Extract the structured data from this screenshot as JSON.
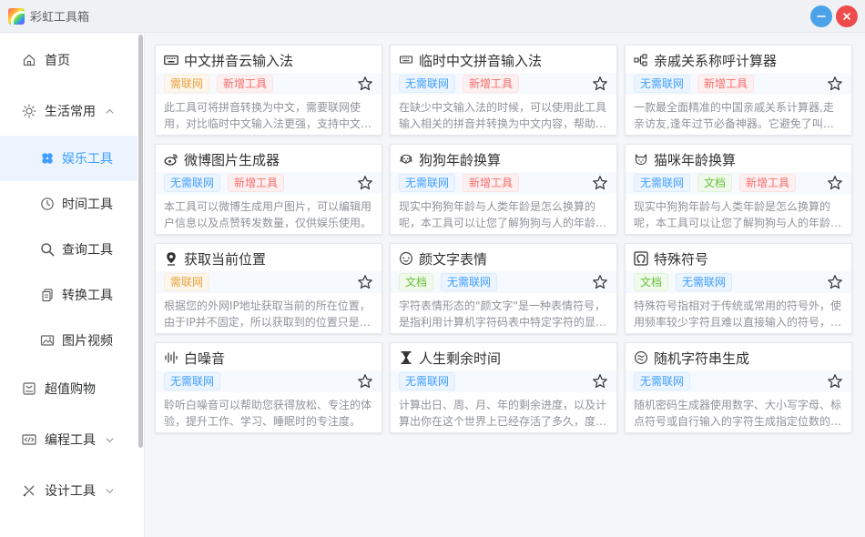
{
  "app": {
    "title": "彩虹工具箱",
    "colors": {
      "accent": "#409eff",
      "minimize": "#4aa3e8",
      "close": "#ee4b4b",
      "active_bg": "#ecf5ff"
    }
  },
  "sidebar": {
    "items": [
      {
        "label": "首页",
        "icon": "home-icon"
      },
      {
        "label": "生活常用",
        "icon": "sun-icon",
        "expanded": true
      },
      {
        "label": "娱乐工具",
        "icon": "clover-icon",
        "active": true
      },
      {
        "label": "时间工具",
        "icon": "clock-icon"
      },
      {
        "label": "查询工具",
        "icon": "search-icon"
      },
      {
        "label": "转换工具",
        "icon": "convert-icon"
      },
      {
        "label": "图片视频",
        "icon": "image-icon"
      },
      {
        "label": "超值购物",
        "icon": "shopping-icon"
      },
      {
        "label": "编程工具",
        "icon": "code-icon",
        "expanded": false
      },
      {
        "label": "设计工具",
        "icon": "design-icon",
        "expanded": false
      }
    ]
  },
  "tags": {
    "online": "需联网",
    "offline": "无需联网",
    "newtool": "新增工具",
    "doc": "文档"
  },
  "cards": [
    {
      "title": "中文拼音云输入法",
      "icon": "keyboard-icon",
      "tags": [
        "需联网",
        "新增工具"
      ],
      "desc": "此工具可将拼音转换为中文，需要联网使用，对比临时中文输入法更强，支持中文…"
    },
    {
      "title": "临时中文拼音输入法",
      "icon": "keyboard-small-icon",
      "tags": [
        "无需联网",
        "新增工具"
      ],
      "desc": "在缺少中文输入法的时候，可以使用此工具输入相关的拼音并转换为中文内容，帮助…"
    },
    {
      "title": "亲戚关系称呼计算器",
      "icon": "relation-icon",
      "tags": [
        "无需联网",
        "新增工具"
      ],
      "desc": "一款最全面精准的中国亲戚关系计算器,走亲访友,逢年过节必备神器。它避免了叫错、…"
    },
    {
      "title": "微博图片生成器",
      "icon": "weibo-icon",
      "tags": [
        "无需联网",
        "新增工具"
      ],
      "desc": "本工具可以微博生成用户图片，可以编辑用户信息以及点赞转发数量，仅供娱乐使用。"
    },
    {
      "title": "狗狗年龄换算",
      "icon": "dog-icon",
      "tags": [
        "无需联网",
        "新增工具"
      ],
      "desc": "现实中狗狗年龄与人类年龄是怎么换算的呢，本工具可以让您了解狗狗与人的年龄…"
    },
    {
      "title": "猫咪年龄换算",
      "icon": "cat-icon",
      "tags": [
        "无需联网",
        "文档",
        "新增工具"
      ],
      "desc": "现实中狗狗年龄与人类年龄是怎么换算的呢，本工具可以让您了解狗狗与人的年龄…"
    },
    {
      "title": "获取当前位置",
      "icon": "location-icon",
      "tags": [
        "需联网"
      ],
      "desc": "根据您的外网IP地址获取当前的所在位置，由于IP并不固定，所以获取到的位置只是…"
    },
    {
      "title": "颜文字表情",
      "icon": "emoticon-icon",
      "tags": [
        "文档",
        "无需联网"
      ],
      "desc": "字符表情形态的\"颜文字\"是一种表情符号，是指利用计算机字符码表中特定字符的显…"
    },
    {
      "title": "特殊符号",
      "icon": "omega-icon",
      "tags": [
        "文档",
        "无需联网"
      ],
      "desc": "特殊符号指相对于传统或常用的符号外，使用频率较少字符且难以直接输入的符号，…"
    },
    {
      "title": "白噪音",
      "icon": "waveform-icon",
      "tags": [
        "无需联网"
      ],
      "desc": "聆听白噪音可以帮助您获得放松、专注的体验，提升工作、学习、睡眠时的专注度。"
    },
    {
      "title": "人生剩余时间",
      "icon": "hourglass-icon",
      "tags": [
        "无需联网"
      ],
      "desc": "计算出日、周、月、年的剩余进度，以及计算出你在这个世界上已经存活了多久，度…"
    },
    {
      "title": "随机字符串生成",
      "icon": "random-icon",
      "tags": [
        "无需联网"
      ],
      "desc": "随机密码生成器使用数字、大小写字母、标点符号或自行输入的字符生成指定位数的…"
    }
  ]
}
